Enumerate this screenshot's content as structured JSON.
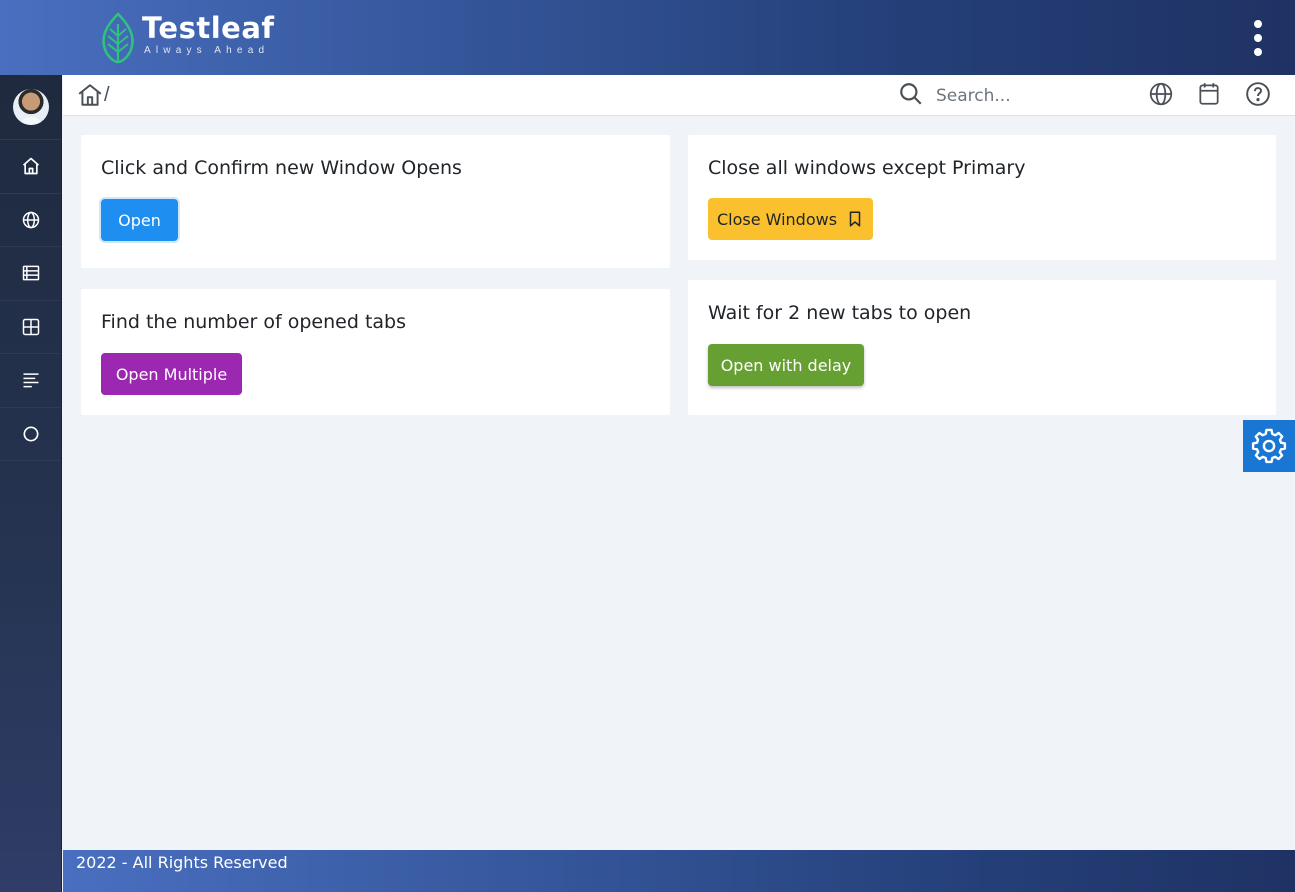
{
  "brand": {
    "name": "Testleaf",
    "tagline": "Always Ahead"
  },
  "header": {
    "menu_icon": "kebab-menu-icon"
  },
  "sidebar": {
    "items": [
      {
        "name": "avatar"
      },
      {
        "icon": "home-icon"
      },
      {
        "icon": "globe-icon"
      },
      {
        "icon": "list-icon"
      },
      {
        "icon": "grid-icon"
      },
      {
        "icon": "align-left-icon"
      },
      {
        "icon": "circle-icon"
      }
    ]
  },
  "breadcrumb": {
    "separator": "/"
  },
  "search": {
    "placeholder": "Search..."
  },
  "cards": {
    "new_window": {
      "title": "Click and Confirm new Window Opens",
      "button": "Open"
    },
    "close_windows": {
      "title": "Close all windows except Primary",
      "button": "Close Windows"
    },
    "opened_tabs": {
      "title": "Find the number of opened tabs",
      "button": "Open Multiple"
    },
    "wait_tabs": {
      "title": "Wait for 2 new tabs to open",
      "button": "Open with delay"
    }
  },
  "footer": {
    "text": "2022 - All Rights Reserved"
  },
  "colors": {
    "primary": "#1e8ff0",
    "warning": "#fbc02d",
    "purple": "#9c27b0",
    "success": "#66a032",
    "settings": "#1976d2"
  }
}
